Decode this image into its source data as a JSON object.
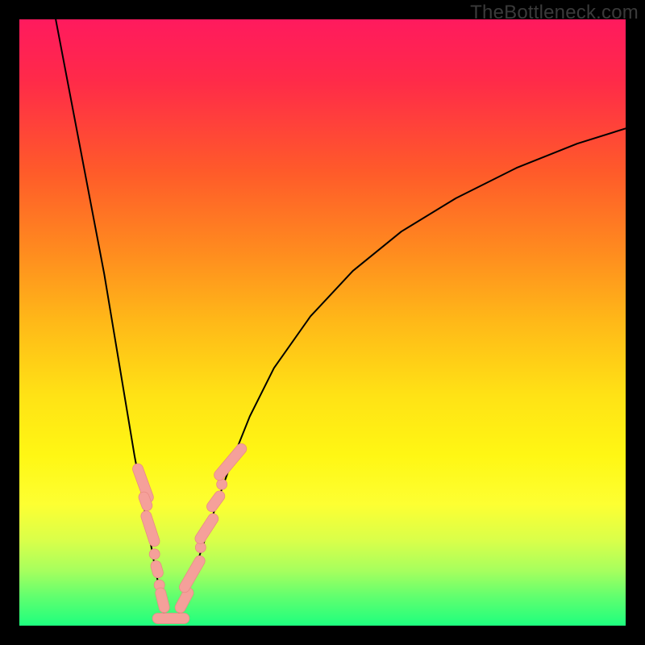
{
  "watermark": {
    "text": "TheBottleneck.com"
  },
  "colors": {
    "curve": "#000000",
    "marker_fill": "#f5a09a",
    "marker_stroke": "#e98b85",
    "background_gradient_top": "#ff1a5e",
    "background_gradient_bottom": "#1eff7e"
  },
  "chart_data": {
    "type": "line",
    "title": "",
    "xlabel": "",
    "ylabel": "",
    "xlim": [
      0,
      100
    ],
    "ylim": [
      0,
      100
    ],
    "grid": false,
    "legend": false,
    "notes": "Two monotone curves descending from top edges toward a narrow flat minimum near x≈24; left branch is steep, right branch is gentler. Markers cluster along both branches near the bottom 30% and a flat segment at y≈1.",
    "series": [
      {
        "name": "left-branch",
        "x": [
          6,
          10,
          14,
          17,
          19,
          20.5,
          21.5,
          22.3,
          23,
          23.6,
          24
        ],
        "y": [
          100,
          79,
          58,
          40,
          28,
          20,
          14.5,
          10,
          6.5,
          3.5,
          1.2
        ]
      },
      {
        "name": "right-branch",
        "x": [
          26,
          27,
          28,
          29.2,
          30.7,
          32.5,
          35,
          38,
          42,
          48,
          55,
          63,
          72,
          82,
          92,
          100
        ],
        "y": [
          1.2,
          3.5,
          6.5,
          10,
          14.5,
          20,
          27,
          34.5,
          42.5,
          51,
          58.5,
          65,
          70.5,
          75.5,
          79.5,
          82
        ]
      },
      {
        "name": "flat-minimum",
        "x": [
          24,
          26
        ],
        "y": [
          1.2,
          1.2
        ]
      }
    ],
    "markers": [
      {
        "branch": "left",
        "shape": "pill",
        "x": 20.4,
        "y": 23.5,
        "len": 4.2,
        "angle": 70
      },
      {
        "branch": "left",
        "shape": "pill",
        "x": 20.8,
        "y": 20.5,
        "len": 2.0,
        "angle": 70
      },
      {
        "branch": "left",
        "shape": "pill",
        "x": 21.6,
        "y": 16.0,
        "len": 3.8,
        "angle": 72
      },
      {
        "branch": "left",
        "shape": "dot",
        "x": 22.3,
        "y": 11.8
      },
      {
        "branch": "left",
        "shape": "pill",
        "x": 22.7,
        "y": 9.3,
        "len": 1.8,
        "angle": 74
      },
      {
        "branch": "left",
        "shape": "dot",
        "x": 23.1,
        "y": 6.7
      },
      {
        "branch": "left",
        "shape": "pill",
        "x": 23.6,
        "y": 4.2,
        "len": 2.6,
        "angle": 76
      },
      {
        "branch": "flat",
        "shape": "pill",
        "x": 25.0,
        "y": 1.2,
        "len": 3.8,
        "angle": 0
      },
      {
        "branch": "right",
        "shape": "pill",
        "x": 27.2,
        "y": 4.2,
        "len": 2.8,
        "angle": -62
      },
      {
        "branch": "right",
        "shape": "pill",
        "x": 28.5,
        "y": 8.5,
        "len": 4.2,
        "angle": -60
      },
      {
        "branch": "right",
        "shape": "dot",
        "x": 29.9,
        "y": 12.9
      },
      {
        "branch": "right",
        "shape": "pill",
        "x": 30.9,
        "y": 16.0,
        "len": 3.5,
        "angle": -57
      },
      {
        "branch": "right",
        "shape": "pill",
        "x": 32.4,
        "y": 20.5,
        "len": 2.4,
        "angle": -54
      },
      {
        "branch": "right",
        "shape": "dot",
        "x": 33.4,
        "y": 23.3
      },
      {
        "branch": "right",
        "shape": "pill",
        "x": 34.8,
        "y": 27.0,
        "len": 4.6,
        "angle": -50
      }
    ]
  }
}
